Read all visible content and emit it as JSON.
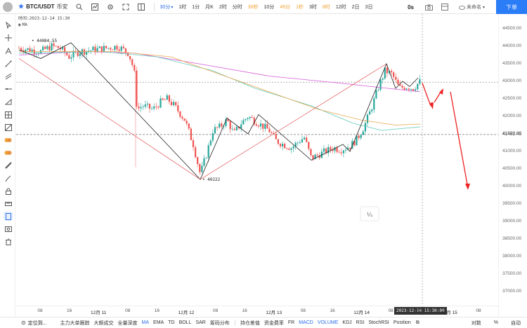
{
  "header": {
    "symbol": "BTC/USDT",
    "market": "币安",
    "timeframes": [
      {
        "label": "30分",
        "selected": true,
        "dropdown": true
      },
      {
        "label": "1时"
      },
      {
        "label": "1分"
      },
      {
        "label": "月K"
      },
      {
        "label": "2时"
      },
      {
        "label": "分时"
      },
      {
        "label": "30秒",
        "amber": true
      },
      {
        "label": "10分"
      },
      {
        "label": "45分",
        "amber": true
      },
      {
        "label": "1秒",
        "amber": true
      },
      {
        "label": "3时"
      },
      {
        "label": "8时",
        "amber": true
      },
      {
        "label": "12时"
      },
      {
        "label": "2日"
      },
      {
        "label": "3日"
      }
    ],
    "countdown": "0s",
    "layout_name": "未命名",
    "order_button": "下单"
  },
  "legend": {
    "datetime": "时间:2023-12-14 15:30",
    "indicator": "MA"
  },
  "chart_data": {
    "type": "candlestick",
    "symbol": "BTC/USDT",
    "interval": "30分",
    "ylim": [
      36700,
      44800
    ],
    "price_ticks": [
      44500,
      44000,
      43500,
      43000,
      42500,
      42000,
      41500,
      41000,
      40500,
      40000,
      39500,
      39000,
      38500,
      38000,
      37500,
      37000
    ],
    "time_ticks": [
      "08",
      "16",
      "12月 11",
      "08",
      "16",
      "12月 12",
      "08",
      "16",
      "12月 13",
      "08",
      "16",
      "12月 14",
      "08",
      "16",
      "12月 15",
      "08"
    ],
    "current_price": 41482.45,
    "crosshair_price": 42975,
    "crosshair_time": "2023-12-14 15:30:00",
    "annotations": {
      "high_label": "44084.55",
      "low_label": "40222"
    },
    "ma_lines": [
      {
        "name": "MA",
        "color": "#d65ad6"
      },
      {
        "name": "MA",
        "color": "#5fc8b8"
      },
      {
        "name": "MA",
        "color": "#e8a84c"
      }
    ],
    "up_color": "#26a69a",
    "down_color": "#ef5350"
  },
  "price_axis_current": "41482.45",
  "timeaxis_cursor": "2023-12-14 15:30:00",
  "watermark_icon": "¼",
  "bottom": {
    "locate": "定位到...",
    "indicators": [
      "主力大单跟踪",
      "大额成交",
      "全量深度",
      "MA",
      "EMA",
      "TD",
      "BOLL",
      "SAR",
      "筹码分布"
    ],
    "indicators_active": [
      "MA"
    ],
    "sub_indicators": [
      "持仓差值",
      "资金费率",
      "FR",
      "MACD",
      "VOLUME",
      "KDJ",
      "RSI",
      "StochRSI",
      "Position"
    ],
    "sub_active": [
      "MACD",
      "VOLUME"
    ],
    "right": [
      "对数",
      "%",
      "自动"
    ]
  }
}
